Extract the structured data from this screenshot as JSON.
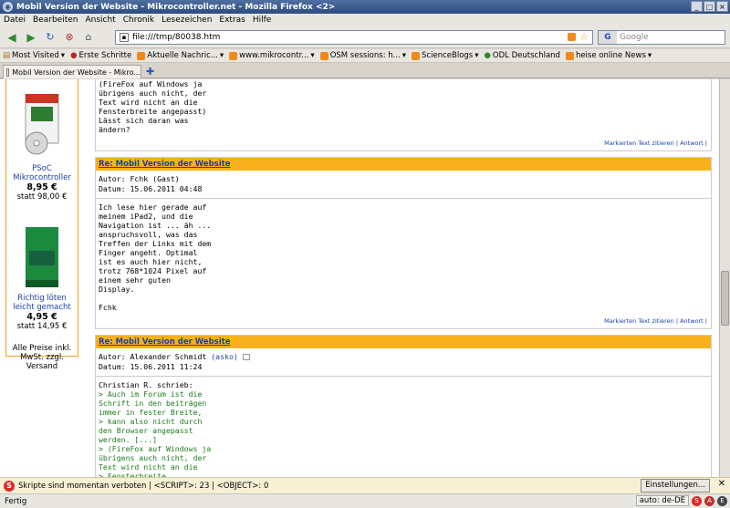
{
  "window": {
    "title": "Mobil Version der Website - Mikrocontroller.net - Mozilla Firefox <2>"
  },
  "menu": [
    "Datei",
    "Bearbeiten",
    "Ansicht",
    "Chronik",
    "Lesezeichen",
    "Extras",
    "Hilfe"
  ],
  "nav": {
    "url": "file:///tmp/80038.htm",
    "search_placeholder": "Google"
  },
  "bookmarks": [
    "Most Visited",
    "Erste Schritte",
    "Aktuelle Nachric...",
    "www.mikrocontr...",
    "OSM sessions: h...",
    "ScienceBlogs",
    "ODL Deutschland",
    "heise online News"
  ],
  "tab": {
    "label": "Mobil Version der Website - Mikro..."
  },
  "sidebar": {
    "book1_title": "PSoC Mikrocontroller",
    "book1_price": "8,95 €",
    "book1_old": "statt 98,00 €",
    "book2_title": "Richtig löten leicht gemacht",
    "book2_price": "4,95 €",
    "book2_old": "statt 14,95 €",
    "note": "Alle Preise inkl. MwSt. zzgl. Versand"
  },
  "posts": [
    {
      "continuation": "(FireFox auf Windows ja\nübrigens auch nicht, der\nText wird nicht an die\nFensterbreite angepasst)\nLässt sich daran was\nändern?",
      "mark": "Markierten Text zitieren",
      "reply": "Antwort"
    },
    {
      "heading": "Re: Mobil Version der Website",
      "author": "Autor: Fchk (Gast)",
      "date": "Datum: 15.06.2011 04:48",
      "body": "Ich lese hier gerade auf\nmeinem iPad2, und die\nNavigation ist ... äh ...\nanspruchsvoll, was das\nTreffen der Links mit dem\nFinger angeht. Optimal\nist es auch hier nicht,\ntrotz 768*1024 Pixel auf\neinem sehr guten\nDisplay.\n\nFchk",
      "mark": "Markierten Text zitieren",
      "reply": "Antwort"
    },
    {
      "heading": "Re: Mobil Version der Website",
      "author": "Autor: Alexander Schmidt",
      "author_link": "(asko)",
      "date": "Datum: 15.06.2011 11:24",
      "intro": "Christian R. schrieb:",
      "quote": "> Auch im Forum ist die\nSchrift in den beiträgen\nimmer in fester Breite,\n> kann also nicht durch\nden Browser angepasst\nwerden. [...]\n> (FireFox auf Windows ja\nübrigens auch nicht, der\nText wird nicht an die\n> Fensterbreite\nangepasst)"
    }
  ],
  "notification": {
    "text": "Skripte sind momentan verboten | <SCRIPT>: 23 | <OBJECT>: 0",
    "button": "Einstellungen..."
  },
  "status": {
    "text": "Fertig",
    "lang": "auto: de-DE"
  }
}
